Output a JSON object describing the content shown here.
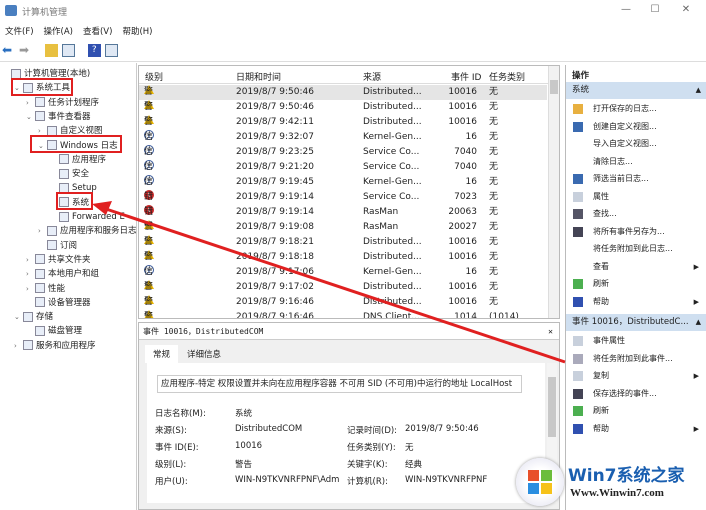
{
  "window": {
    "title": "计算机管理",
    "min": "—",
    "max": "☐",
    "close": "✕"
  },
  "menu": [
    "文件(F)",
    "操作(A)",
    "查看(V)",
    "帮助(H)"
  ],
  "tree": [
    {
      "label": "计算机管理(本地)",
      "indent": 0,
      "arrow": ""
    },
    {
      "label": "系统工具",
      "indent": 1,
      "arrow": "⌄"
    },
    {
      "label": "任务计划程序",
      "indent": 2,
      "arrow": "›"
    },
    {
      "label": "事件查看器",
      "indent": 2,
      "arrow": "⌄"
    },
    {
      "label": "自定义视图",
      "indent": 3,
      "arrow": "›"
    },
    {
      "label": "Windows 日志",
      "indent": 3,
      "arrow": "⌄"
    },
    {
      "label": "应用程序",
      "indent": 4,
      "arrow": ""
    },
    {
      "label": "安全",
      "indent": 4,
      "arrow": ""
    },
    {
      "label": "Setup",
      "indent": 4,
      "arrow": ""
    },
    {
      "label": "系统",
      "indent": 4,
      "arrow": ""
    },
    {
      "label": "Forwarded E",
      "indent": 4,
      "arrow": ""
    },
    {
      "label": "应用程序和服务日志",
      "indent": 3,
      "arrow": "›"
    },
    {
      "label": "订阅",
      "indent": 3,
      "arrow": ""
    },
    {
      "label": "共享文件夹",
      "indent": 2,
      "arrow": "›"
    },
    {
      "label": "本地用户和组",
      "indent": 2,
      "arrow": "›"
    },
    {
      "label": "性能",
      "indent": 2,
      "arrow": "›"
    },
    {
      "label": "设备管理器",
      "indent": 2,
      "arrow": ""
    },
    {
      "label": "存储",
      "indent": 1,
      "arrow": "⌄"
    },
    {
      "label": "磁盘管理",
      "indent": 2,
      "arrow": ""
    },
    {
      "label": "服务和应用程序",
      "indent": 1,
      "arrow": "›"
    }
  ],
  "list": {
    "columns": [
      "级别",
      "日期和时间",
      "来源",
      "事件 ID",
      "任务类别"
    ],
    "rows": [
      {
        "level": "警告",
        "type": "warn",
        "time": "2019/8/7 9:50:46",
        "source": "Distributed...",
        "id": "10016",
        "cat": "无"
      },
      {
        "level": "警告",
        "type": "warn",
        "time": "2019/8/7 9:50:46",
        "source": "Distributed...",
        "id": "10016",
        "cat": "无"
      },
      {
        "level": "警告",
        "type": "warn",
        "time": "2019/8/7 9:42:11",
        "source": "Distributed...",
        "id": "10016",
        "cat": "无"
      },
      {
        "level": "信息",
        "type": "info",
        "time": "2019/8/7 9:32:07",
        "source": "Kernel-Gen...",
        "id": "16",
        "cat": "无"
      },
      {
        "level": "信息",
        "type": "info",
        "time": "2019/8/7 9:23:25",
        "source": "Service Co...",
        "id": "7040",
        "cat": "无"
      },
      {
        "level": "信息",
        "type": "info",
        "time": "2019/8/7 9:21:20",
        "source": "Service Co...",
        "id": "7040",
        "cat": "无"
      },
      {
        "level": "信息",
        "type": "info",
        "time": "2019/8/7 9:19:45",
        "source": "Kernel-Gen...",
        "id": "16",
        "cat": "无"
      },
      {
        "level": "错误",
        "type": "err",
        "time": "2019/8/7 9:19:14",
        "source": "Service Co...",
        "id": "7023",
        "cat": "无"
      },
      {
        "level": "错误",
        "type": "err",
        "time": "2019/8/7 9:19:14",
        "source": "RasMan",
        "id": "20063",
        "cat": "无"
      },
      {
        "level": "警告",
        "type": "warn",
        "time": "2019/8/7 9:19:08",
        "source": "RasMan",
        "id": "20027",
        "cat": "无"
      },
      {
        "level": "警告",
        "type": "warn",
        "time": "2019/8/7 9:18:21",
        "source": "Distributed...",
        "id": "10016",
        "cat": "无"
      },
      {
        "level": "警告",
        "type": "warn",
        "time": "2019/8/7 9:18:18",
        "source": "Distributed...",
        "id": "10016",
        "cat": "无"
      },
      {
        "level": "信息",
        "type": "info",
        "time": "2019/8/7 9:17:06",
        "source": "Kernel-Gen...",
        "id": "16",
        "cat": "无"
      },
      {
        "level": "警告",
        "type": "warn",
        "time": "2019/8/7 9:17:02",
        "source": "Distributed...",
        "id": "10016",
        "cat": "无"
      },
      {
        "level": "警告",
        "type": "warn",
        "time": "2019/8/7 9:16:46",
        "source": "Distributed...",
        "id": "10016",
        "cat": "无"
      },
      {
        "level": "警告",
        "type": "warn",
        "time": "2019/8/7 9:16:46",
        "source": "DNS Client...",
        "id": "1014",
        "cat": "(1014)"
      }
    ]
  },
  "detail": {
    "title": "事件 10016，DistributedCOM",
    "close": "✕",
    "tabs": [
      "常规",
      "详细信息"
    ],
    "message": "应用程序-特定 权限设置并未向在应用程序容器 不可用 SID (不可用)中运行的地址 LocalHost",
    "fields": [
      {
        "k": "日志名称(M):",
        "v": "系统"
      },
      {
        "k": "来源(S):",
        "v": "DistributedCOM",
        "k2": "记录时间(D):",
        "v2": "2019/8/7 9:50:46"
      },
      {
        "k": "事件 ID(E):",
        "v": "10016",
        "k2": "任务类别(Y):",
        "v2": "无"
      },
      {
        "k": "级别(L):",
        "v": "警告",
        "k2": "关键字(K):",
        "v2": "经典"
      },
      {
        "k": "用户(U):",
        "v": "WIN-N9TKVNRFPNF\\Adm",
        "k2": "计算机(R):",
        "v2": "WIN-N9TKVNRFPNF"
      }
    ]
  },
  "actions": {
    "header": "操作",
    "sections": [
      {
        "title": "系统",
        "items": [
          {
            "label": "打开保存的日志...",
            "icon": "folder-icon",
            "sub": false
          },
          {
            "label": "创建自定义视图...",
            "icon": "filter-icon",
            "sub": false
          },
          {
            "label": "导入自定义视图...",
            "icon": "",
            "sub": false
          },
          {
            "label": "清除日志...",
            "icon": "",
            "sub": false
          },
          {
            "label": "筛选当前日志...",
            "icon": "filter-icon",
            "sub": false
          },
          {
            "label": "属性",
            "icon": "properties-icon",
            "sub": false
          },
          {
            "label": "查找...",
            "icon": "binoculars-icon",
            "sub": false
          },
          {
            "label": "将所有事件另存为...",
            "icon": "save-icon",
            "sub": false
          },
          {
            "label": "将任务附加到此日志...",
            "icon": "",
            "sub": false
          },
          {
            "label": "查看",
            "icon": "",
            "sub": true
          },
          {
            "label": "刷新",
            "icon": "refresh-icon",
            "sub": false
          },
          {
            "label": "帮助",
            "icon": "help-icon",
            "sub": true
          }
        ]
      },
      {
        "title": "事件 10016，DistributedC...",
        "items": [
          {
            "label": "事件属性",
            "icon": "properties-icon",
            "sub": false
          },
          {
            "label": "将任务附加到此事件...",
            "icon": "task-icon",
            "sub": false
          },
          {
            "label": "复制",
            "icon": "copy-icon",
            "sub": true
          },
          {
            "label": "保存选择的事件...",
            "icon": "save-icon",
            "sub": false
          },
          {
            "label": "刷新",
            "icon": "refresh-icon",
            "sub": false
          },
          {
            "label": "帮助",
            "icon": "help-icon",
            "sub": true
          }
        ]
      }
    ]
  },
  "watermark": {
    "name": "Win7系统之家",
    "url": "Www.Winwin7.com"
  },
  "colors": {
    "annotation": "#e02020",
    "section": "#cfdff0",
    "warn": "#e8b400",
    "error": "#c62828"
  }
}
